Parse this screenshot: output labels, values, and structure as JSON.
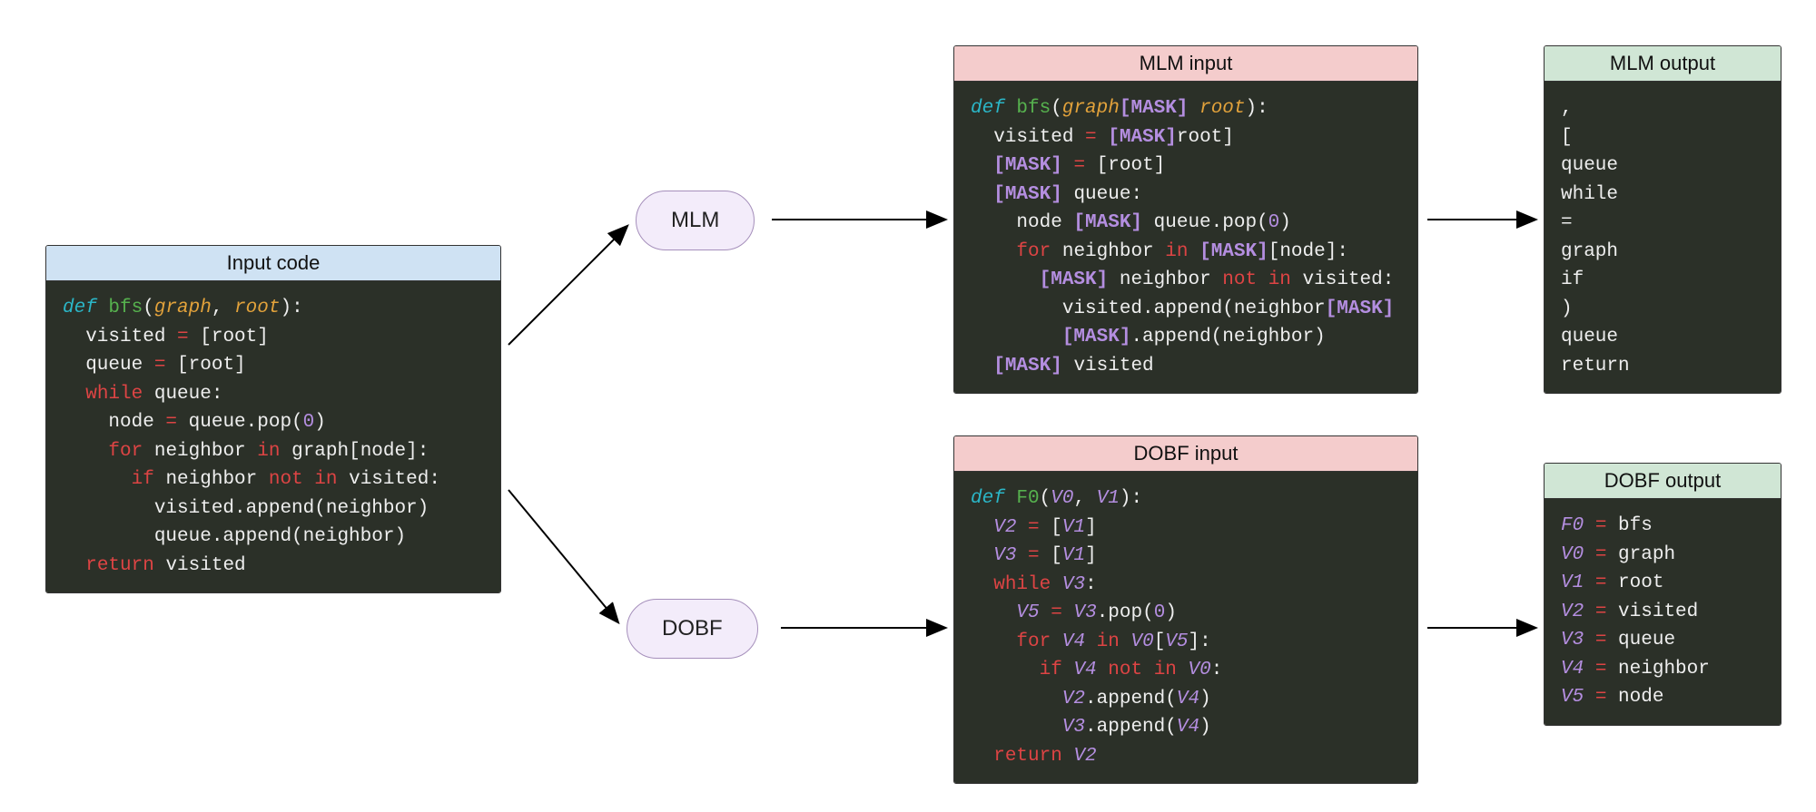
{
  "input": {
    "title": "Input code",
    "code_html": "<span class='kw-def'>def</span> <span class='kw-fn'>bfs</span>(<span class='kw-arg'>graph</span>, <span class='kw-arg'>root</span>):\n  visited <span class='kw-op'>=</span> [root]\n  queue <span class='kw-op'>=</span> [root]\n  <span class='kw-flow'>while</span> queue:\n    node <span class='kw-op'>=</span> queue.pop(<span class='kw-num'>0</span>)\n    <span class='kw-flow'>for</span> neighbor <span class='kw-flow'>in</span> graph[node]:\n      <span class='kw-flow'>if</span> neighbor <span class='kw-flow'>not in</span> visited:\n        visited.append(neighbor)\n        queue.append(neighbor)\n  <span class='kw-flow'>return</span> visited"
  },
  "nodes": {
    "mlm": "MLM",
    "dobf": "DOBF"
  },
  "mlm_input": {
    "title": "MLM input",
    "code_html": "<span class='kw-def'>def</span> <span class='kw-fn'>bfs</span>(<span class='kw-arg'>graph</span><span class='kw-mask'>[MASK]</span> <span class='kw-arg'>root</span>):\n  visited <span class='kw-op'>=</span> <span class='kw-mask'>[MASK]</span>root]\n  <span class='kw-mask'>[MASK]</span> <span class='kw-op'>=</span> [root]\n  <span class='kw-mask'>[MASK]</span> queue:\n    node <span class='kw-mask'>[MASK]</span> queue.pop(<span class='kw-num'>0</span>)\n    <span class='kw-flow'>for</span> neighbor <span class='kw-flow'>in</span> <span class='kw-mask'>[MASK]</span>[node]:\n      <span class='kw-mask'>[MASK]</span> neighbor <span class='kw-flow'>not in</span> visited:\n        visited.append(neighbor<span class='kw-mask'>[MASK]</span>\n        <span class='kw-mask'>[MASK]</span>.append(neighbor)\n  <span class='kw-mask'>[MASK]</span> visited"
  },
  "mlm_output": {
    "title": "MLM output",
    "code_html": ",\n[\nqueue\nwhile\n=\ngraph\nif\n)\nqueue\nreturn"
  },
  "dobf_input": {
    "title": "DOBF input",
    "code_html": "<span class='kw-def'>def</span> <span class='kw-fn'>F0</span>(<span class='kw-var'>V0</span>, <span class='kw-var'>V1</span>):\n  <span class='kw-var'>V2</span> <span class='kw-op'>=</span> [<span class='kw-var'>V1</span>]\n  <span class='kw-var'>V3</span> <span class='kw-op'>=</span> [<span class='kw-var'>V1</span>]\n  <span class='kw-flow'>while</span> <span class='kw-var'>V3</span>:\n    <span class='kw-var'>V5</span> <span class='kw-op'>=</span> <span class='kw-var'>V3</span>.pop(<span class='kw-num'>0</span>)\n    <span class='kw-flow'>for</span> <span class='kw-var'>V4</span> <span class='kw-flow'>in</span> <span class='kw-var'>V0</span>[<span class='kw-var'>V5</span>]:\n      <span class='kw-flow'>if</span> <span class='kw-var'>V4</span> <span class='kw-flow'>not in</span> <span class='kw-var'>V0</span>:\n        <span class='kw-var'>V2</span>.append(<span class='kw-var'>V4</span>)\n        <span class='kw-var'>V3</span>.append(<span class='kw-var'>V4</span>)\n  <span class='kw-flow'>return</span> <span class='kw-var'>V2</span>"
  },
  "dobf_output": {
    "title": "DOBF output",
    "code_html": "<span class='kw-var'>F0</span> <span class='kw-op'>=</span> bfs\n<span class='kw-var'>V0</span> <span class='kw-op'>=</span> graph\n<span class='kw-var'>V1</span> <span class='kw-op'>=</span> root\n<span class='kw-var'>V2</span> <span class='kw-op'>=</span> visited\n<span class='kw-var'>V3</span> <span class='kw-op'>=</span> queue\n<span class='kw-var'>V4</span> <span class='kw-op'>=</span> neighbor\n<span class='kw-var'>V5</span> <span class='kw-op'>=</span> node"
  }
}
